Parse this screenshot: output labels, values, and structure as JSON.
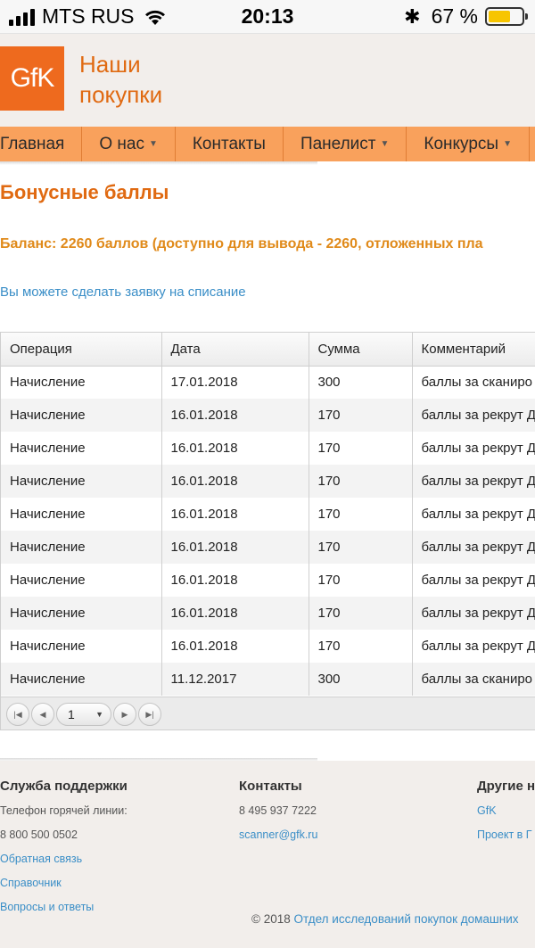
{
  "status_bar": {
    "carrier": "MTS RUS",
    "time": "20:13",
    "battery_percent": "67 %",
    "battery_level": 0.67,
    "battery_color": "#f7c500"
  },
  "header": {
    "logo_text": "GfK",
    "site_name_line1": "Наши",
    "site_name_line2": "покупки"
  },
  "nav": {
    "items": [
      {
        "label": "Главная"
      },
      {
        "label": "О нас"
      },
      {
        "label": "Контакты"
      },
      {
        "label": "Панелист"
      },
      {
        "label": "Конкурсы"
      }
    ]
  },
  "main": {
    "title": "Бонусные баллы",
    "balance": "Баланс: 2260 баллов (доступно для вывода - 2260, отложенных пла",
    "withdraw_link": "Вы можете сделать заявку на списание"
  },
  "table": {
    "headers": [
      "Операция",
      "Дата",
      "Сумма",
      "Комментарий"
    ],
    "rows": [
      [
        "Начисление",
        "17.01.2018",
        "300",
        "баллы за сканиро"
      ],
      [
        "Начисление",
        "16.01.2018",
        "170",
        "баллы за рекрут Д"
      ],
      [
        "Начисление",
        "16.01.2018",
        "170",
        "баллы за рекрут Д"
      ],
      [
        "Начисление",
        "16.01.2018",
        "170",
        "баллы за рекрут Д"
      ],
      [
        "Начисление",
        "16.01.2018",
        "170",
        "баллы за рекрут Д"
      ],
      [
        "Начисление",
        "16.01.2018",
        "170",
        "баллы за рекрут Д"
      ],
      [
        "Начисление",
        "16.01.2018",
        "170",
        "баллы за рекрут Д"
      ],
      [
        "Начисление",
        "16.01.2018",
        "170",
        "баллы за рекрут Д"
      ],
      [
        "Начисление",
        "16.01.2018",
        "170",
        "баллы за рекрут Д"
      ],
      [
        "Начисление",
        "11.12.2017",
        "300",
        "баллы за сканиро"
      ]
    ],
    "pager": {
      "current_page": "1"
    }
  },
  "footer": {
    "support": {
      "title": "Служба поддержки",
      "hotline_label": "Телефон горячей линии:",
      "hotline_number": "8 800 500 0502",
      "links": [
        "Обратная связь",
        "Справочник",
        "Вопросы и ответы"
      ]
    },
    "contacts": {
      "title": "Контакты",
      "phone": "8 495 937 7222",
      "email": "scanner@gfk.ru"
    },
    "other": {
      "title": "Другие н",
      "links": [
        "GfK",
        "Проект в Г"
      ]
    },
    "copyright_prefix": "© 2018",
    "copyright_link": "Отдел исследований покупок домашних"
  },
  "colors": {
    "accent": "#e06a12",
    "nav_bg": "#f9a15c",
    "link": "#3a8ec7"
  }
}
